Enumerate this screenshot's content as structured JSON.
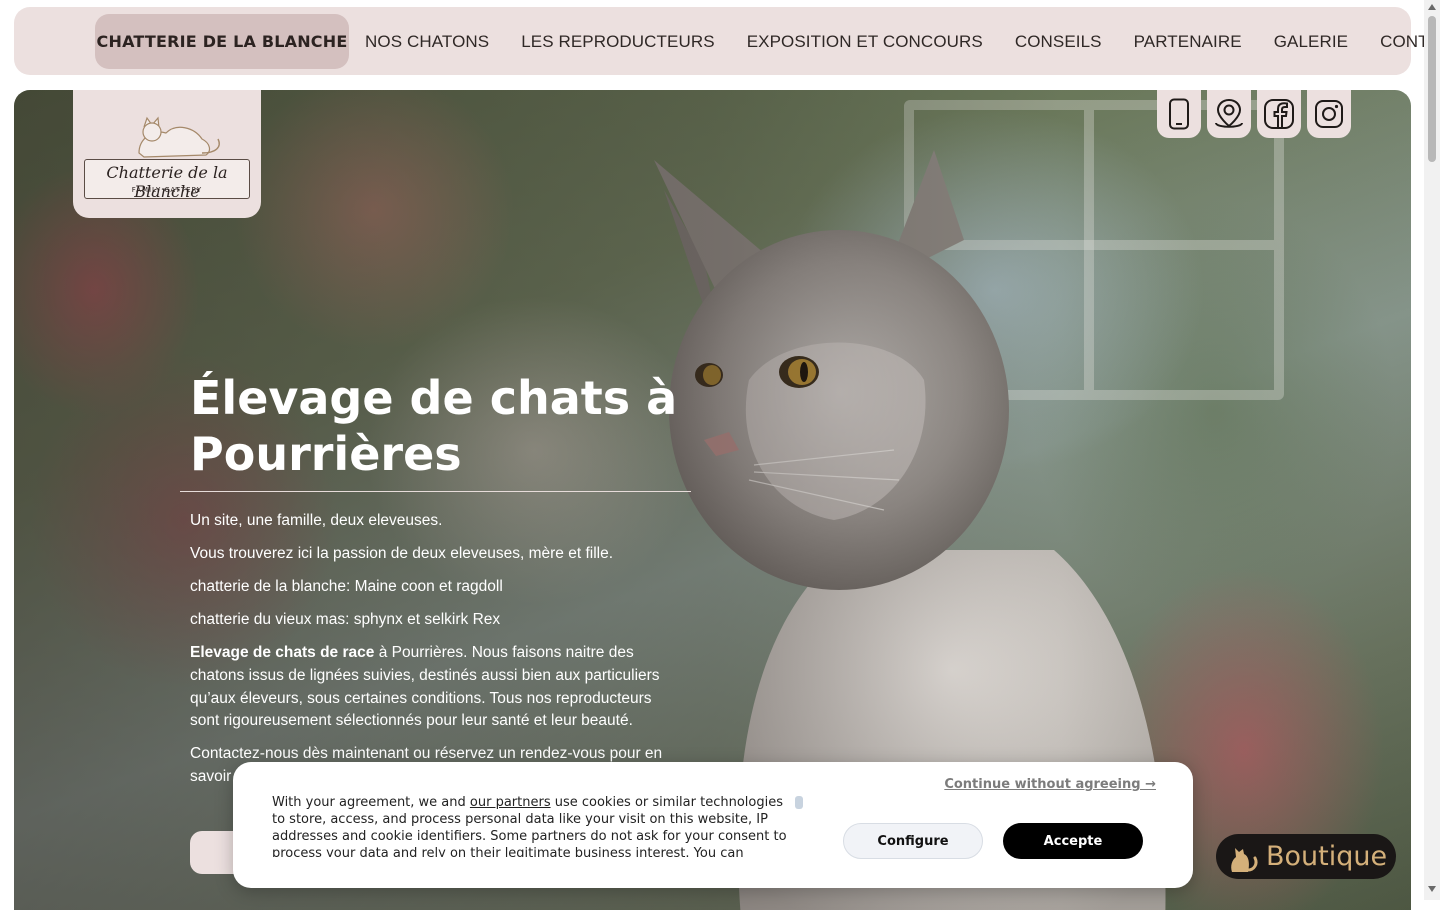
{
  "nav": {
    "brand": "CHATTERIE DE LA BLANCHE",
    "links": [
      "NOS CHATONS",
      "LES REPRODUCTEURS",
      "EXPOSITION ET CONCOURS",
      "CONSEILS",
      "PARTENAIRE",
      "GALERIE",
      "CONTACT"
    ]
  },
  "logo": {
    "script": "Chatterie de la Blanche",
    "sub": "FAMILY CATTERY"
  },
  "socials": [
    "phone-icon",
    "map-pin-icon",
    "facebook-icon",
    "instagram-icon"
  ],
  "hero": {
    "title": "Élevage de chats à Pourrières",
    "p1": "Un site, une famille, deux eleveuses.",
    "p2": "Vous trouverez ici la passion de deux eleveuses, mère et fille.",
    "p3": "chatterie de la blanche: Maine coon et ragdoll",
    "p4": "chatterie du vieux mas: sphynx et selkirk Rex",
    "p5_bold": "Elevage de chats de race",
    "p5_rest": " à Pourrières. Nous faisons naitre des chatons issus de lignées suivies, destinés aussi bien aux particuliers qu’aux éleveurs, sous certaines conditions. Tous nos reproducteurs sont rigoureusement sélectionnés pour leur santé et leur beauté.",
    "p6": "Contactez-nous dès maintenant ou réservez un rendez-vous pour en savoir plus"
  },
  "boutique": {
    "label": "Boutique"
  },
  "cookie": {
    "continue": "Continue without agreeing →",
    "text_before": "With your agreement, we and ",
    "text_link": "our partners",
    "text_after": " use cookies or similar technologies to store, access, and process personal data like your visit on this website, IP addresses and cookie identifiers. Some partners do not ask for your consent to process your data and rely on their legitimate business interest. You can",
    "configure": "Configure",
    "accept": "Accepte"
  },
  "colors": {
    "nav_bg": "#ece0df",
    "brand_bg": "#d4c0bf",
    "accept_bg": "#000000",
    "boutique_text": "#d4b07a"
  }
}
